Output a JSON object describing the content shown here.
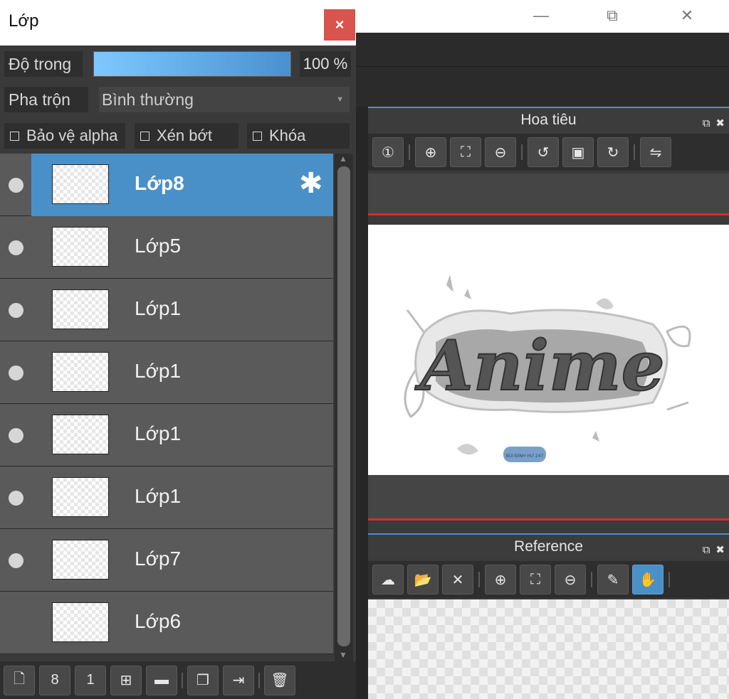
{
  "window_controls": {
    "minimize": "—",
    "maximize": "⧉",
    "close": "✕"
  },
  "navigator": {
    "title": "Hoa tiêu",
    "toolbar": [
      {
        "icon": "zoom-actual-icon",
        "glyph": "①"
      },
      {
        "icon": "zoom-in-icon",
        "glyph": "⊕"
      },
      {
        "icon": "fit-screen-icon",
        "glyph": "⛶"
      },
      {
        "icon": "zoom-out-icon",
        "glyph": "⊖"
      },
      {
        "icon": "rotate-left-icon",
        "glyph": "↺"
      },
      {
        "icon": "fit-canvas-icon",
        "glyph": "▣"
      },
      {
        "icon": "rotate-right-icon",
        "glyph": "↻"
      },
      {
        "icon": "flip-horizontal-icon",
        "glyph": "⇋"
      }
    ],
    "artwork_text": "Anime",
    "artwork_badge": "BÙI ĐÌNH HƯ 247"
  },
  "reference": {
    "title": "Reference",
    "toolbar": [
      {
        "icon": "cloud-download-icon",
        "glyph": "☁"
      },
      {
        "icon": "open-folder-icon",
        "glyph": "📂"
      },
      {
        "icon": "close-icon",
        "glyph": "✕"
      },
      {
        "icon": "zoom-in-icon",
        "glyph": "⊕"
      },
      {
        "icon": "fit-screen-icon",
        "glyph": "⛶"
      },
      {
        "icon": "zoom-out-icon",
        "glyph": "⊖"
      },
      {
        "icon": "eyedropper-icon",
        "glyph": "✎"
      },
      {
        "icon": "hand-tool-icon",
        "glyph": "✋",
        "active": true
      }
    ]
  },
  "layer_panel": {
    "title": "Lớp",
    "close": "×",
    "opacity_label": "Độ trong",
    "opacity_value": "100 %",
    "opacity_fraction": 1.0,
    "blend_label": "Pha trộn",
    "blend_value": "Bình thường",
    "protect_alpha": "Bảo vệ alpha",
    "clipping": "Xén bớt",
    "lock": "Khóa",
    "layers": [
      {
        "name": "Lớp8",
        "visible": true,
        "selected": true,
        "thumb": ""
      },
      {
        "name": "Lớp5",
        "visible": true,
        "selected": false,
        "thumb": ""
      },
      {
        "name": "Lớp1",
        "visible": true,
        "selected": false,
        "thumb": ""
      },
      {
        "name": "Lớp1",
        "visible": true,
        "selected": false,
        "thumb": ""
      },
      {
        "name": "Lớp1",
        "visible": true,
        "selected": false,
        "thumb": ""
      },
      {
        "name": "Lớp1",
        "visible": true,
        "selected": false,
        "thumb": ""
      },
      {
        "name": "Lớp7",
        "visible": true,
        "selected": false,
        "thumb": ""
      },
      {
        "name": "Lớp6",
        "visible": false,
        "selected": false,
        "thumb": ""
      }
    ],
    "bottom_tools": [
      {
        "icon": "new-layer-icon",
        "glyph": "🗋"
      },
      {
        "icon": "new-8bit-layer-icon",
        "glyph": "8"
      },
      {
        "icon": "new-1bit-layer-icon",
        "glyph": "1"
      },
      {
        "icon": "add-layer-menu-icon",
        "glyph": "⊞"
      },
      {
        "icon": "new-folder-icon",
        "glyph": "▬"
      },
      {
        "icon": "duplicate-layer-icon",
        "glyph": "❐"
      },
      {
        "icon": "merge-down-icon",
        "glyph": "⇥"
      },
      {
        "icon": "delete-layer-icon",
        "glyph": "🗑"
      }
    ]
  }
}
